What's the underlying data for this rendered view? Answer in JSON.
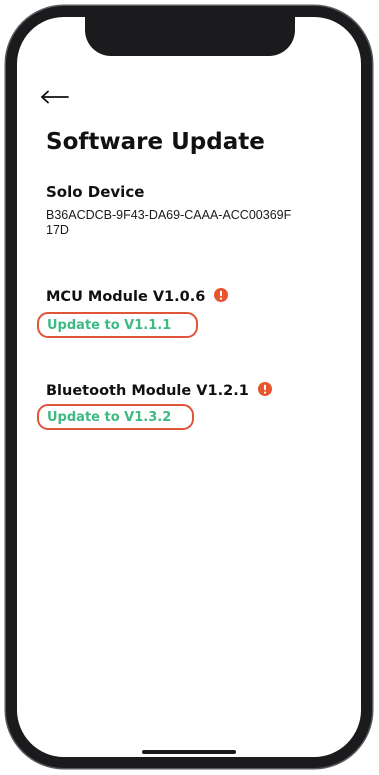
{
  "header": {
    "back_icon": "arrow-left-icon",
    "title": "Software Update"
  },
  "device": {
    "name": "Solo Device",
    "id": "B36ACDCB-9F43-DA69-CAAA-ACC00369F17D"
  },
  "modules": [
    {
      "title": "MCU Module V1.0.6",
      "status_icon": "warning-icon",
      "update_label": "Update to V1.1.1"
    },
    {
      "title": "Bluetooth Module V1.2.1",
      "status_icon": "warning-icon",
      "update_label": "Update to V1.3.2"
    }
  ],
  "colors": {
    "warning": "#e8542e",
    "update_text": "#3dba82",
    "highlight_outline": "#e0553a",
    "text": "#111111"
  }
}
